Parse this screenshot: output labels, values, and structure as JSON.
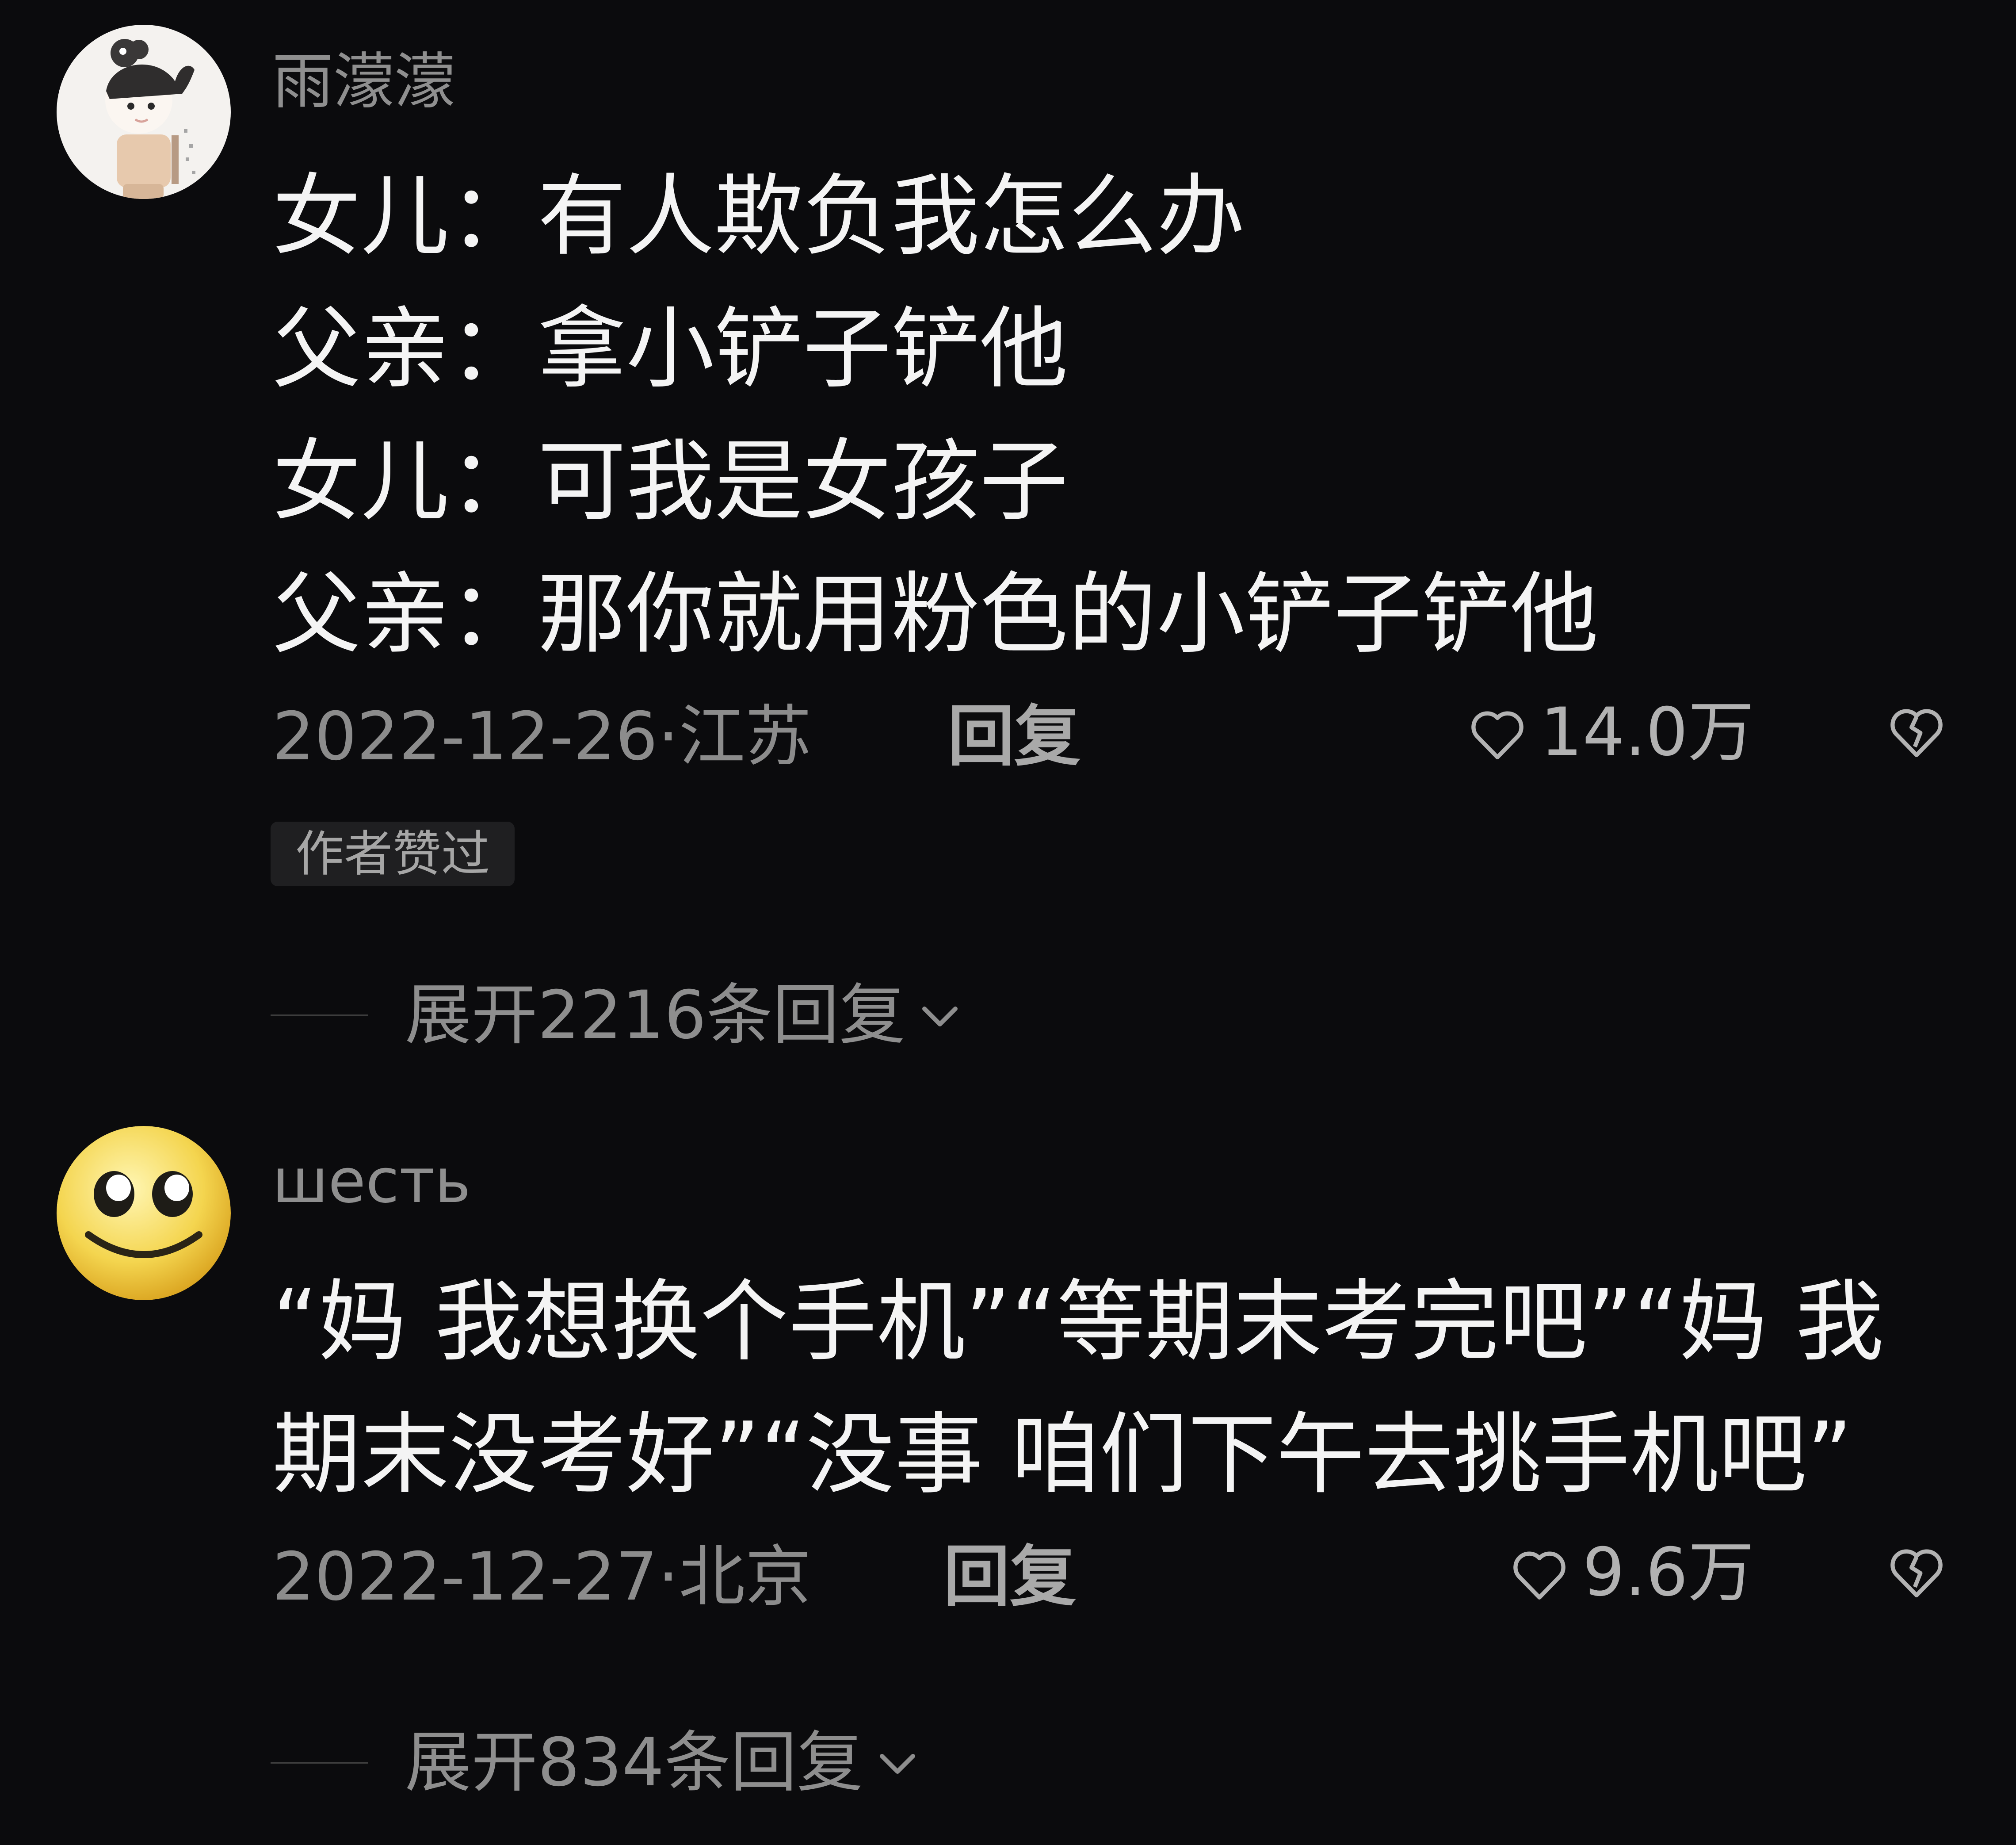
{
  "comments": [
    {
      "username": "雨濛濛",
      "lines": [
        "女儿：有人欺负我怎么办",
        "父亲：拿小铲子铲他",
        "女儿：可我是女孩子",
        "父亲：那你就用粉色的小铲子铲他"
      ],
      "date_location": "2022-12-26·江苏",
      "reply_label": "回复",
      "likes": "14.0万",
      "badge": "作者赞过",
      "expand_label": "展开2216条回复"
    },
    {
      "username": "шесть",
      "text": "“妈 我想换个手机”“等期末考完吧”“妈 我期末没考好”“没事 咱们下午去挑手机吧”",
      "date_location": "2022-12-27·北京",
      "reply_label": "回复",
      "likes": "9.6万",
      "expand_label": "展开834条回复"
    }
  ],
  "colors": {
    "background": "#0b0b0d",
    "text_primary": "#f4f4f4",
    "text_secondary": "#8c8c8c",
    "badge_background": "#1f1f21"
  },
  "icons": {
    "like": "heart-outline-icon",
    "dislike": "broken-heart-icon",
    "expand": "chevron-down-icon"
  }
}
